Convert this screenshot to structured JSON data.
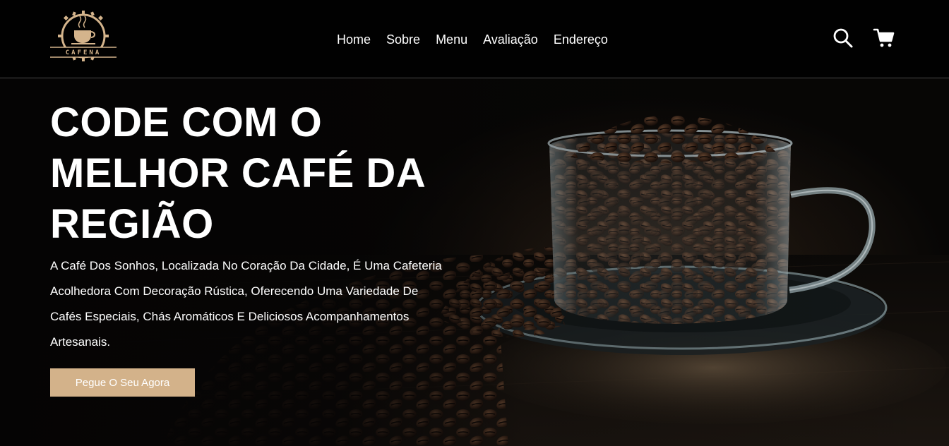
{
  "brand": {
    "logo_text": "CAFENA",
    "accent_color": "#d3b28a"
  },
  "nav": {
    "items": [
      {
        "label": "Home"
      },
      {
        "label": "Sobre"
      },
      {
        "label": "Menu"
      },
      {
        "label": "Avaliação"
      },
      {
        "label": "Endereço"
      }
    ]
  },
  "header_icons": {
    "search": "search-icon",
    "cart": "cart-icon"
  },
  "hero": {
    "title": "CODE COM O MELHOR CAFÉ DA REGIÃO",
    "description": "A Café Dos Sonhos, Localizada No Coração Da Cidade, É Uma Cafeteria Acolhedora Com Decoração Rústica, Oferecendo Uma Variedade De Cafés Especiais, Chás Aromáticos E Deliciosos Acompanhamentos Artesanais.",
    "cta_label": "Pegue O Seu Agora",
    "image": "coffee-beans-in-glass-cup"
  }
}
